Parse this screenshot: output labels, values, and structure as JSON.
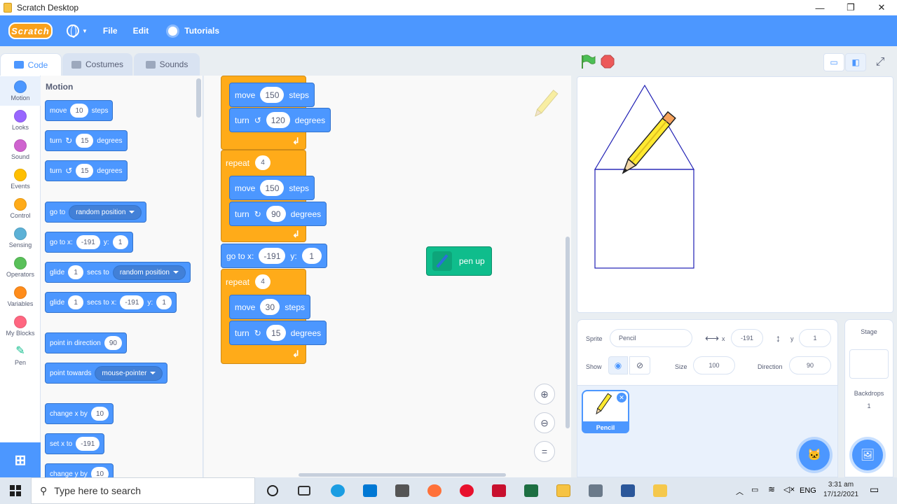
{
  "window": {
    "title": "Scratch Desktop",
    "minimize": "—",
    "restore": "❐",
    "close": "✕"
  },
  "menubar": {
    "logo": "Scratch",
    "file": "File",
    "edit": "Edit",
    "tutorials": "Tutorials"
  },
  "tabs": {
    "code": "Code",
    "costumes": "Costumes",
    "sounds": "Sounds"
  },
  "categories": [
    {
      "label": "Motion",
      "color": "#4c97ff"
    },
    {
      "label": "Looks",
      "color": "#9966ff"
    },
    {
      "label": "Sound",
      "color": "#cf63cf"
    },
    {
      "label": "Events",
      "color": "#ffbf00"
    },
    {
      "label": "Control",
      "color": "#ffab19"
    },
    {
      "label": "Sensing",
      "color": "#5cb1d6"
    },
    {
      "label": "Operators",
      "color": "#59c059"
    },
    {
      "label": "Variables",
      "color": "#ff8c1a"
    },
    {
      "label": "My Blocks",
      "color": "#ff6680"
    },
    {
      "label": "Pen",
      "color": "#0fbd8c"
    }
  ],
  "palette": {
    "title": "Motion",
    "move": {
      "a": "move",
      "v": "10",
      "b": "steps"
    },
    "turn_right": {
      "a": "turn",
      "icon": "↻",
      "v": "15",
      "b": "degrees"
    },
    "turn_left": {
      "a": "turn",
      "icon": "↺",
      "v": "15",
      "b": "degrees"
    },
    "goto": {
      "a": "go to",
      "drop": "random position"
    },
    "gotoxy": {
      "a": "go to x:",
      "x": "-191",
      "b": "y:",
      "y": "1"
    },
    "glide1": {
      "a": "glide",
      "v": "1",
      "b": "secs to",
      "drop": "random position"
    },
    "glide2": {
      "a": "glide",
      "v": "1",
      "b": "secs to x:",
      "x": "-191",
      "c": "y:",
      "y": "1"
    },
    "point_dir": {
      "a": "point in direction",
      "v": "90"
    },
    "point_towards": {
      "a": "point towards",
      "drop": "mouse-pointer"
    },
    "change_x": {
      "a": "change x by",
      "v": "10"
    },
    "set_x": {
      "a": "set x to",
      "v": "-191"
    },
    "change_y": {
      "a": "change y by",
      "v": "10"
    }
  },
  "script": {
    "move1": {
      "a": "move",
      "v": "150",
      "b": "steps"
    },
    "turn1": {
      "a": "turn",
      "icon": "↺",
      "v": "120",
      "b": "degrees"
    },
    "repeat1": {
      "a": "repeat",
      "v": "4"
    },
    "move2": {
      "a": "move",
      "v": "150",
      "b": "steps"
    },
    "turn2": {
      "a": "turn",
      "icon": "↻",
      "v": "90",
      "b": "degrees"
    },
    "gotoxy": {
      "a": "go to x:",
      "x": "-191",
      "b": "y:",
      "y": "1"
    },
    "repeat2": {
      "a": "repeat",
      "v": "4"
    },
    "move3": {
      "a": "move",
      "v": "30",
      "b": "steps"
    },
    "turn3": {
      "a": "turn",
      "icon": "↻",
      "v": "15",
      "b": "degrees"
    },
    "loop_arrow": "↲",
    "penup": "pen up"
  },
  "sprite_info": {
    "sprite_label": "Sprite",
    "sprite_name": "Pencil",
    "x_label": "x",
    "x": "-191",
    "y_label": "y",
    "y": "1",
    "show_label": "Show",
    "size_label": "Size",
    "size": "100",
    "direction_label": "Direction",
    "direction": "90"
  },
  "sprite_card": {
    "name": "Pencil"
  },
  "stage_pane": {
    "title": "Stage",
    "backdrops_label": "Backdrops",
    "backdrops_count": "1"
  },
  "taskbar": {
    "search_placeholder": "Type here to search",
    "language": "ENG",
    "time": "3:31 am",
    "date": "17/12/2021"
  }
}
